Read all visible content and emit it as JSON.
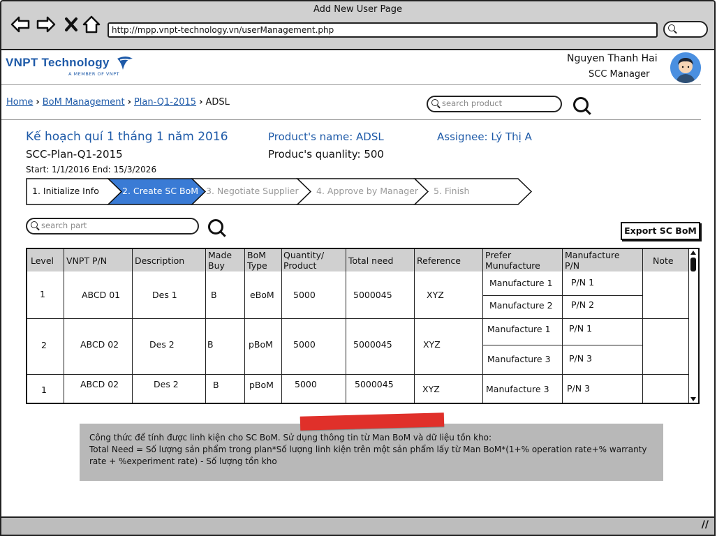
{
  "window": {
    "title": "Add New User Page",
    "url": "http://mpp.vnpt-technology.vn/userManagement.php",
    "nav_icons": [
      "back-arrow-icon",
      "forward-arrow-icon",
      "close-icon",
      "home-icon"
    ]
  },
  "header": {
    "brand": "VNPT Technology",
    "brand_sub": "A MEMBER OF VNPT",
    "user_name": "Nguyen Thanh Hai",
    "user_role": "SCC Manager"
  },
  "breadcrumb": {
    "items": [
      "Home",
      "BoM Management",
      "Plan-Q1-2015"
    ],
    "current": "ADSL"
  },
  "product_search": {
    "placeholder": "search product"
  },
  "plan": {
    "title": "Kế hoạch quí 1 tháng 1 năm 2016",
    "code": "SCC-Plan-Q1-2015",
    "dates": "Start: 1/1/2016 End: 15/3/2026",
    "product_name": "Product's name: ADSL",
    "product_qty": "Produc's quanlity: 500",
    "assignee": "Assignee: Lý Thị A"
  },
  "steps": [
    {
      "label": "1. Initialize Info",
      "state": "done"
    },
    {
      "label": "2. Create SC BoM",
      "state": "active"
    },
    {
      "label": "3. Negotiate Supplier",
      "state": "pending"
    },
    {
      "label": "4. Approve by Manager",
      "state": "pending"
    },
    {
      "label": "5. Finish",
      "state": "pending"
    }
  ],
  "part_search": {
    "placeholder": "search part"
  },
  "export_label": "Export SC BoM",
  "table": {
    "headers": {
      "level": "Level",
      "pn": "VNPT P/N",
      "desc": "Description",
      "made1": "Made",
      "made2": "Buy",
      "bom1": "BoM",
      "bom2": "Type",
      "qty1": "Quantity/",
      "qty2": "Product",
      "total": "Total need",
      "ref": "Reference",
      "prefer1": "Prefer",
      "prefer2": "Munufacture",
      "mpn1": "Manufacture",
      "mpn2": "P/N",
      "note": "Note"
    },
    "rows": [
      {
        "level": "1",
        "pn": "ABCD 01",
        "desc": "Des 1",
        "made": "B",
        "bom": "eBoM",
        "qty": "5000",
        "total": "5000045",
        "ref": "XYZ",
        "m1": "Manufacture 1",
        "p1": "P/N 1",
        "m2": "Manufacture 2",
        "p2": "P/N 2"
      },
      {
        "level": "2",
        "pn": "ABCD 02",
        "desc": "Des 2",
        "made": "B",
        "bom": "pBoM",
        "qty": "5000",
        "total": "5000045",
        "ref": "XYZ",
        "m1": "Manufacture 1",
        "p1": "P/N 1",
        "m2": "Manufacture 3",
        "p2": "P/N 3"
      },
      {
        "level": "1",
        "pn": "ABCD 02",
        "desc": "Des 2",
        "made": "B",
        "bom": "pBoM",
        "qty": "5000",
        "total": "5000045",
        "ref": "XYZ",
        "m1": "Manufacture 3",
        "p1": "P/N 3"
      }
    ]
  },
  "note": {
    "line1": "Công thức để tính được linh kiện cho SC BoM. Sử dụng thông tin từ Man BoM và dữ liệu tồn kho:",
    "line2": "Total Need = Số lượng sản phẩm trong plan*Số lượng linh kiện trên một sản phẩm lấy từ Man BoM*(1+% operation rate+% warranty rate + %experiment rate) - Số lượng tồn kho"
  },
  "colors": {
    "brand": "#1e5aa8",
    "active_step": "#3a7bd5",
    "note_bg": "#b8b8b8",
    "tape": "#e0302a"
  }
}
